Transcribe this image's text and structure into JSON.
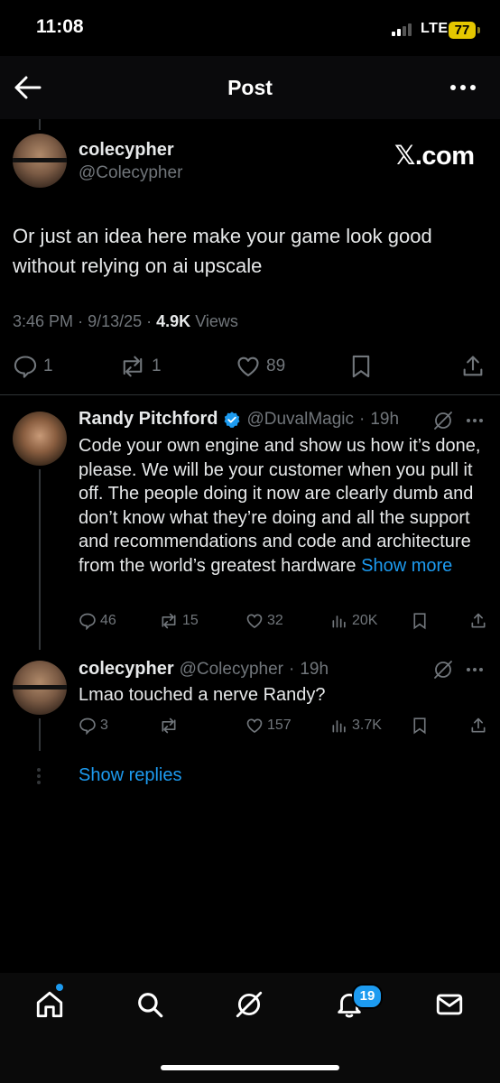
{
  "status_bar": {
    "time": "11:08",
    "network": "LTE",
    "battery": "77"
  },
  "header": {
    "title": "Post"
  },
  "main_post": {
    "author_name": "colecypher",
    "author_handle": "@Colecypher",
    "source_label": "𝕏.com",
    "text": "Or just an idea here make your game look good without relying on ai upscale",
    "time": "3:46 PM",
    "date": "9/13/25",
    "views_count": "4.9K",
    "views_label": "Views",
    "replies": "1",
    "reposts": "1",
    "likes": "89"
  },
  "replies": [
    {
      "author_name": "Randy Pitchford",
      "author_handle": "@DuvalMagic",
      "age": "19h",
      "text": "Code your own engine and show us how it’s done, please.  We will be your customer when you pull it off. The people doing it now are clearly dumb and don’t know what they’re doing and all the support and recommendations and code and architecture from the world’s greatest hardware",
      "show_more": "Show more",
      "replies": "46",
      "reposts": "15",
      "likes": "32",
      "views": "20K"
    },
    {
      "author_name": "colecypher",
      "author_handle": "@Colecypher",
      "age": "19h",
      "text": "Lmao touched a nerve Randy?",
      "replies": "3",
      "reposts": "",
      "likes": "157",
      "views": "3.7K"
    }
  ],
  "show_replies": "Show replies",
  "tab_bar": {
    "notifications_badge": "19",
    "tabs": [
      "home-icon",
      "search-icon",
      "grok-icon",
      "bell-icon",
      "mail-icon"
    ]
  },
  "colors": {
    "background": "#000000",
    "accent": "#1d9bf0",
    "muted": "#71767b",
    "text": "#e7e9ea",
    "verified": "#1d9bf0"
  }
}
